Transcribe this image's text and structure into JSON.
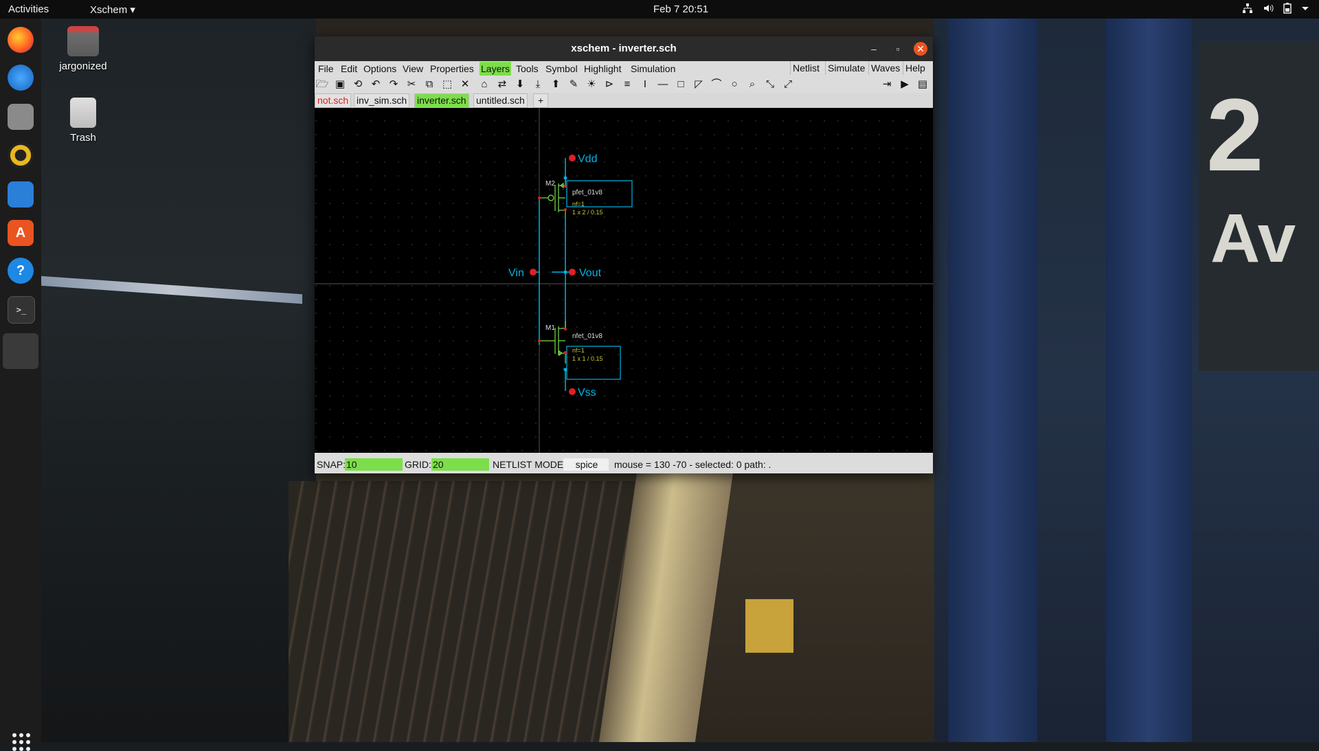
{
  "topbar": {
    "activities": "Activities",
    "app_menu": "Xschem ▾",
    "clock": "Feb 7  20:51",
    "tray_icons": [
      "network-icon",
      "volume-icon",
      "battery-icon",
      "system-menu-icon"
    ]
  },
  "desktop": {
    "icons": [
      {
        "label": "jargonized",
        "icon": "home-folder-icon"
      },
      {
        "label": "Trash",
        "icon": "trash-icon"
      }
    ]
  },
  "dock": {
    "items": [
      "firefox-icon",
      "thunderbird-icon",
      "files-icon",
      "rhythmbox-icon",
      "writer-icon",
      "software-icon",
      "help-icon",
      "terminal-icon",
      "window-icon"
    ]
  },
  "window": {
    "title": "xschem - inverter.sch",
    "menus": [
      "File",
      "Edit",
      "Options",
      "View",
      "Properties",
      "Layers",
      "Tools",
      "Symbol",
      "Highlight",
      "Simulation"
    ],
    "highlighted_menu": "Layers",
    "right_buttons": [
      "Netlist",
      "Simulate",
      "Waves",
      "Help"
    ],
    "tabs": [
      "not.sch",
      "inv_sim.sch",
      "inverter.sch",
      "untitled.sch",
      "+"
    ],
    "active_tab": "inverter.sch",
    "accent_color": "#7cde4a",
    "status": {
      "snap_label": "SNAP:",
      "snap_value": "10",
      "grid_label": "GRID:",
      "grid_value": "20",
      "netlist_label": "NETLIST MODE:",
      "netlist_value": "spice",
      "mouse_info": "mouse = 130 -70 - selected: 0 path: ."
    }
  },
  "schematic": {
    "pins": {
      "vdd": "Vdd",
      "vin": "Vin",
      "vout": "Vout",
      "vss": "Vss"
    },
    "m2": {
      "name": "M2",
      "model": "pfet_01v8",
      "nf": "nf=1",
      "size": "1 x 2 / 0.15"
    },
    "m1": {
      "name": "M1",
      "model": "nfet_01v8",
      "nf": "nf=1",
      "size": "1 x 1 / 0.15"
    },
    "colors": {
      "wire": "#00b4e6",
      "pin": "#e02020",
      "symbol": "#7cde4a",
      "attr": "#c8c832",
      "text": "#dddddd"
    }
  }
}
